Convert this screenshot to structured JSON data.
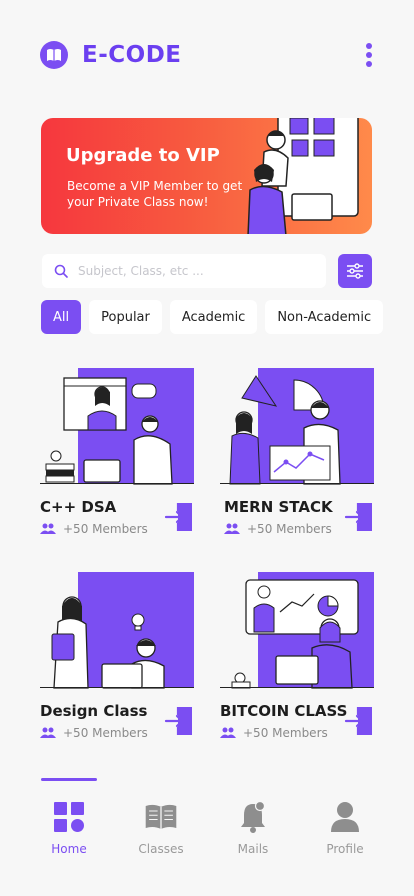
{
  "app": {
    "title": "E-CODE",
    "logo_icon": "book-icon",
    "menu_icon": "kebab-menu-icon"
  },
  "banner": {
    "title": "Upgrade to VIP",
    "subtitle": "Become a VIP Member to get your Private Class now!"
  },
  "search": {
    "placeholder": "Subject, Class, etc ...",
    "icon": "search-icon",
    "filter_icon": "sliders-icon"
  },
  "chips": [
    {
      "label": "All",
      "active": true
    },
    {
      "label": "Popular",
      "active": false
    },
    {
      "label": "Academic",
      "active": false
    },
    {
      "label": "Non-Academic",
      "active": false
    }
  ],
  "courses": [
    {
      "title": "C++ DSA",
      "members": "+50 Members"
    },
    {
      "title": "MERN STACK",
      "members": "+50 Members"
    },
    {
      "title": "Design Class",
      "members": "+50 Members"
    },
    {
      "title": "BITCOIN CLASS",
      "members": "+50 Members"
    }
  ],
  "nav": [
    {
      "label": "Home",
      "icon": "grid-icon",
      "active": true
    },
    {
      "label": "Classes",
      "icon": "open-book-icon",
      "active": false
    },
    {
      "label": "Mails",
      "icon": "bell-icon",
      "active": false
    },
    {
      "label": "Profile",
      "icon": "user-icon",
      "active": false
    }
  ],
  "colors": {
    "accent": "#7b4ef2",
    "banner_start": "#f6373e",
    "banner_end": "#ff8a4a"
  }
}
